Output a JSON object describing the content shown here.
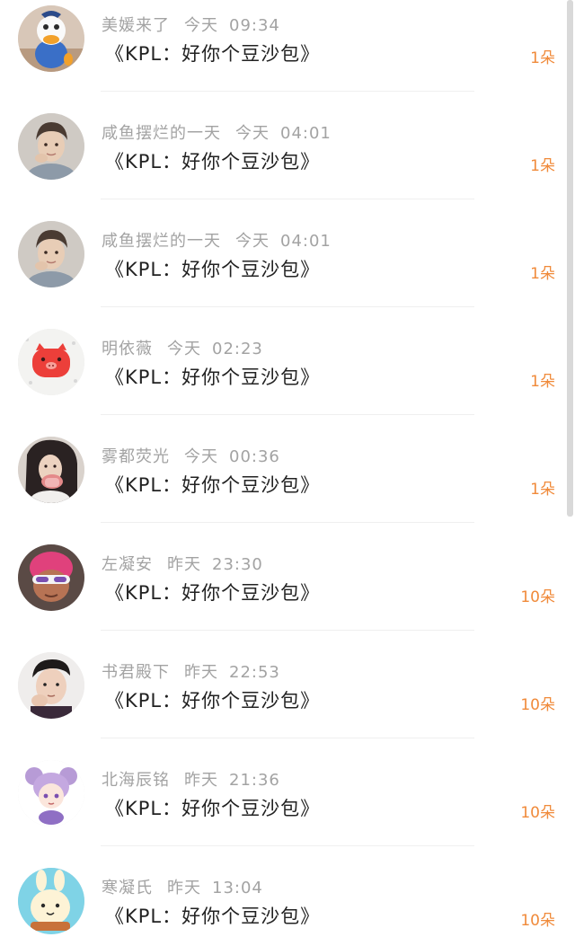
{
  "message_list": [
    {
      "author": "美媛来了",
      "day": "今天",
      "time": "09:34",
      "message": "《KPL：好你个豆沙包》",
      "count": "1朵",
      "avatar": "duck-avatar-icon"
    },
    {
      "author": "咸鱼摆烂的一天",
      "day": "今天",
      "time": "04:01",
      "message": "《KPL：好你个豆沙包》",
      "count": "1朵",
      "avatar": "person-avatar-icon"
    },
    {
      "author": "咸鱼摆烂的一天",
      "day": "今天",
      "time": "04:01",
      "message": "《KPL：好你个豆沙包》",
      "count": "1朵",
      "avatar": "person-avatar-icon"
    },
    {
      "author": "明依薇",
      "day": "今天",
      "time": "02:23",
      "message": "《KPL：好你个豆沙包》",
      "count": "1朵",
      "avatar": "pig-avatar-icon"
    },
    {
      "author": "雾都荧光",
      "day": "今天",
      "time": "00:36",
      "message": "《KPL：好你个豆沙包》",
      "count": "1朵",
      "avatar": "girl-avatar-icon"
    },
    {
      "author": "左凝安",
      "day": "昨天",
      "time": "23:30",
      "message": "《KPL：好你个豆沙包》",
      "count": "10朵",
      "avatar": "cartoon-avatar-icon"
    },
    {
      "author": "书君殿下",
      "day": "昨天",
      "time": "22:53",
      "message": "《KPL：好你个豆沙包》",
      "count": "10朵",
      "avatar": "man-avatar-icon"
    },
    {
      "author": "北海辰铭",
      "day": "昨天",
      "time": "21:36",
      "message": "《KPL：好你个豆沙包》",
      "count": "10朵",
      "avatar": "anime-girl-avatar-icon"
    },
    {
      "author": "寒凝氏",
      "day": "昨天",
      "time": "13:04",
      "message": "《KPL：好你个豆沙包》",
      "count": "10朵",
      "avatar": "bunny-avatar-icon"
    }
  ],
  "colors": {
    "count_accent": "#f08a3a",
    "name_gray": "#a3a3a3",
    "message_text": "#222222"
  }
}
